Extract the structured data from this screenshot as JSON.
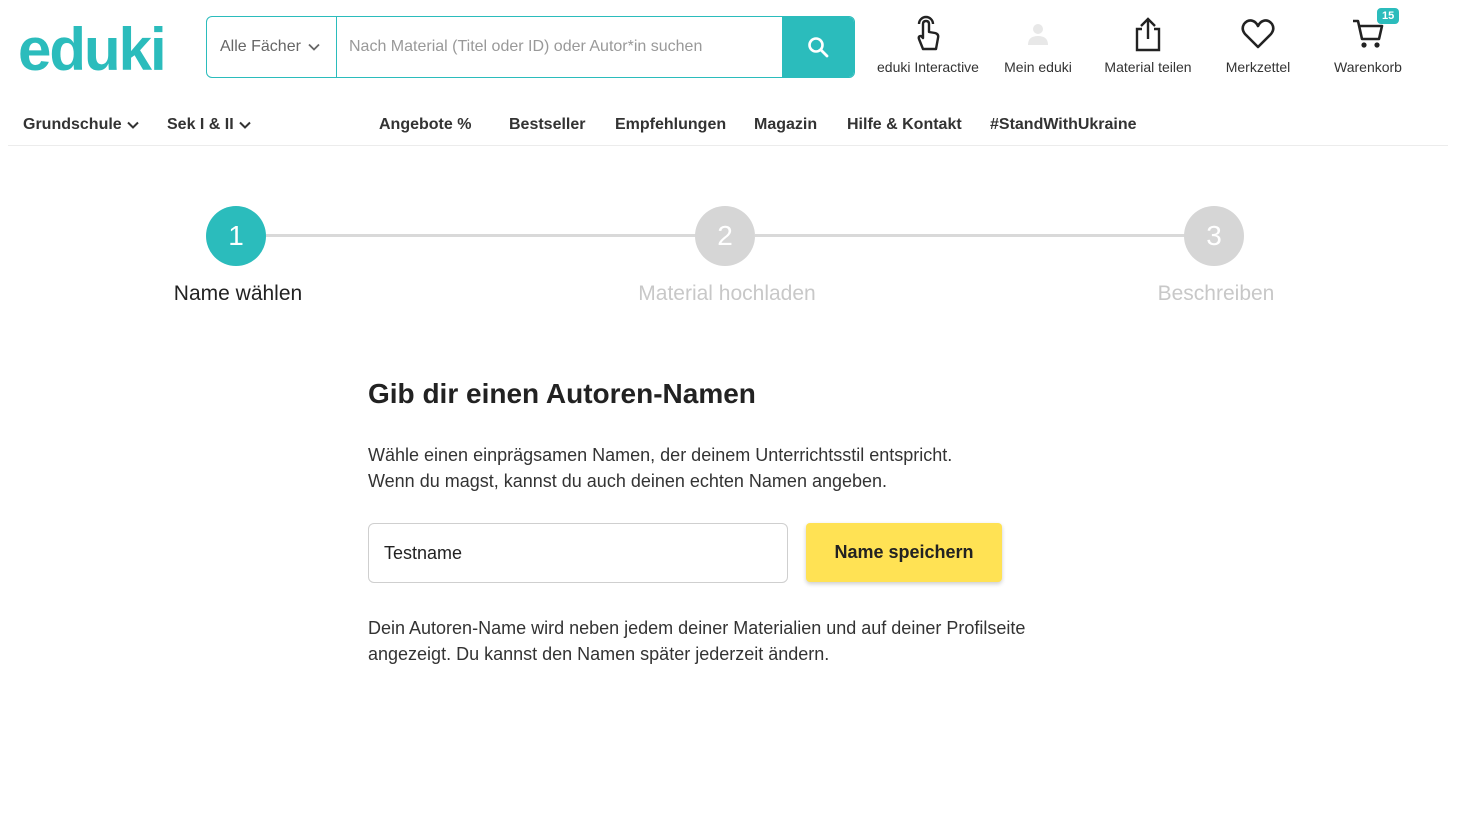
{
  "brand": {
    "logo_text": "eduki",
    "accent": "#2bbcbc",
    "button_yellow": "#ffe254"
  },
  "search": {
    "subject_select": "Alle Fächer",
    "placeholder": "Nach Material (Titel oder ID) oder Autor*in suchen",
    "button_icon": "search-icon"
  },
  "header_actions": [
    {
      "label": "eduki Interactive",
      "icon": "touch-hand-icon"
    },
    {
      "label": "Mein eduki",
      "icon": "user-icon"
    },
    {
      "label": "Material teilen",
      "icon": "share-upload-icon"
    },
    {
      "label": "Merkzettel",
      "icon": "heart-icon"
    },
    {
      "label": "Warenkorb",
      "icon": "cart-icon",
      "badge": "15"
    }
  ],
  "nav": {
    "grundschule": "Grundschule",
    "sek": "Sek I & II",
    "angebote": "Angebote %",
    "bestseller": "Bestseller",
    "empfehlungen": "Empfehlungen",
    "magazin": "Magazin",
    "hilfe": "Hilfe & Kontakt",
    "ukraine": "#StandWithUkraine"
  },
  "stepper": {
    "steps": [
      {
        "number": "1",
        "label": "Name wählen",
        "state": "active"
      },
      {
        "number": "2",
        "label": "Material hochladen",
        "state": "inactive"
      },
      {
        "number": "3",
        "label": "Beschreiben",
        "state": "inactive"
      }
    ]
  },
  "content": {
    "heading": "Gib dir einen Autoren-Namen",
    "intro_line1": "Wähle einen einprägsamen Namen, der deinem Unterrichtsstil entspricht.",
    "intro_line2": "Wenn du magst, kannst du auch deinen echten Namen angeben.",
    "name_value": "Testname",
    "save_label": "Name speichern",
    "note_line1": "Dein Autoren-Name wird neben jedem deiner Materialien und auf deiner Profilseite",
    "note_line2": "angezeigt. Du kannst den Namen später jederzeit ändern."
  }
}
